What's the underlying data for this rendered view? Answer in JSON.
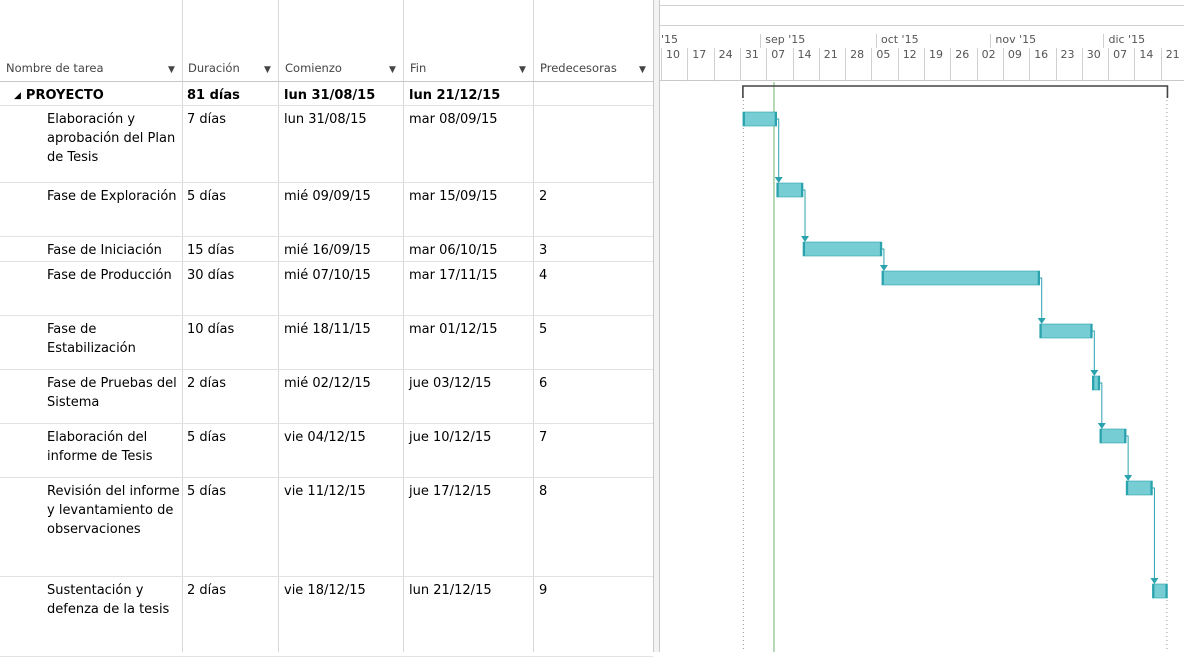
{
  "table": {
    "columns": [
      {
        "key": "name",
        "label": "Nombre de tarea",
        "has_dropdown": true
      },
      {
        "key": "duration",
        "label": "Duración",
        "has_dropdown": true
      },
      {
        "key": "start",
        "label": "Comienzo",
        "has_dropdown": true
      },
      {
        "key": "finish",
        "label": "Fin",
        "has_dropdown": true
      },
      {
        "key": "predecessors",
        "label": "Predecesoras",
        "has_dropdown": true
      }
    ],
    "summary": {
      "name": "PROYECTO",
      "duration": "81 días",
      "start": "lun 31/08/15",
      "finish": "lun 21/12/15",
      "predecessors": ""
    },
    "tasks": [
      {
        "name": "Elaboración y aprobación del Plan de Tesis",
        "duration": "7 días",
        "start": "lun 31/08/15",
        "finish": "mar 08/09/15",
        "predecessors": ""
      },
      {
        "name": "Fase de Exploración",
        "duration": "5 días",
        "start": "mié 09/09/15",
        "finish": "mar 15/09/15",
        "predecessors": "2"
      },
      {
        "name": "Fase de Iniciación",
        "duration": "15 días",
        "start": "mié 16/09/15",
        "finish": "mar 06/10/15",
        "predecessors": "3"
      },
      {
        "name": "Fase de Producción",
        "duration": "30 días",
        "start": "mié 07/10/15",
        "finish": "mar 17/11/15",
        "predecessors": "4"
      },
      {
        "name": "Fase de Estabilización",
        "duration": "10 días",
        "start": "mié 18/11/15",
        "finish": "mar 01/12/15",
        "predecessors": "5"
      },
      {
        "name": "Fase de Pruebas del Sistema",
        "duration": "2 días",
        "start": "mié 02/12/15",
        "finish": "jue 03/12/15",
        "predecessors": "6"
      },
      {
        "name": "Elaboración del informe de Tesis",
        "duration": "5 días",
        "start": "vie 04/12/15",
        "finish": "jue 10/12/15",
        "predecessors": "7"
      },
      {
        "name": "Revisión del informe y levantamiento de observaciones",
        "duration": "5 días",
        "start": "vie 11/12/15",
        "finish": "jue 17/12/15",
        "predecessors": "8"
      },
      {
        "name": "Sustentación y defenza de la tesis",
        "duration": "2 días",
        "start": "vie 18/12/15",
        "finish": "lun 21/12/15",
        "predecessors": "9"
      }
    ]
  },
  "gantt": {
    "timescale": {
      "months": [
        "'15",
        "sep '15",
        "oct '15",
        "nov '15",
        "dic '15"
      ],
      "days": [
        "10",
        "17",
        "24",
        "31",
        "07",
        "14",
        "21",
        "28",
        "05",
        "12",
        "19",
        "26",
        "02",
        "09",
        "16",
        "23",
        "30",
        "07",
        "14",
        "21"
      ]
    },
    "timeline_start": "2015-08-10",
    "today_marker": "2015-09-08",
    "colors": {
      "bar": "#76cdd3",
      "bar_edge": "#2aa3ae",
      "arrow": "#2aa3ae",
      "summary": "#444444",
      "today": "#8fc48f",
      "grid": "#d0d0d0"
    },
    "summary_bar": {
      "start": "2015-08-31",
      "finish": "2015-12-21"
    },
    "bars": [
      {
        "start": "2015-08-31",
        "finish": "2015-09-08"
      },
      {
        "start": "2015-09-09",
        "finish": "2015-09-15"
      },
      {
        "start": "2015-09-16",
        "finish": "2015-10-06"
      },
      {
        "start": "2015-10-07",
        "finish": "2015-11-17"
      },
      {
        "start": "2015-11-18",
        "finish": "2015-12-01"
      },
      {
        "start": "2015-12-02",
        "finish": "2015-12-03"
      },
      {
        "start": "2015-12-04",
        "finish": "2015-12-10"
      },
      {
        "start": "2015-12-11",
        "finish": "2015-12-17"
      },
      {
        "start": "2015-12-18",
        "finish": "2015-12-21"
      }
    ]
  }
}
